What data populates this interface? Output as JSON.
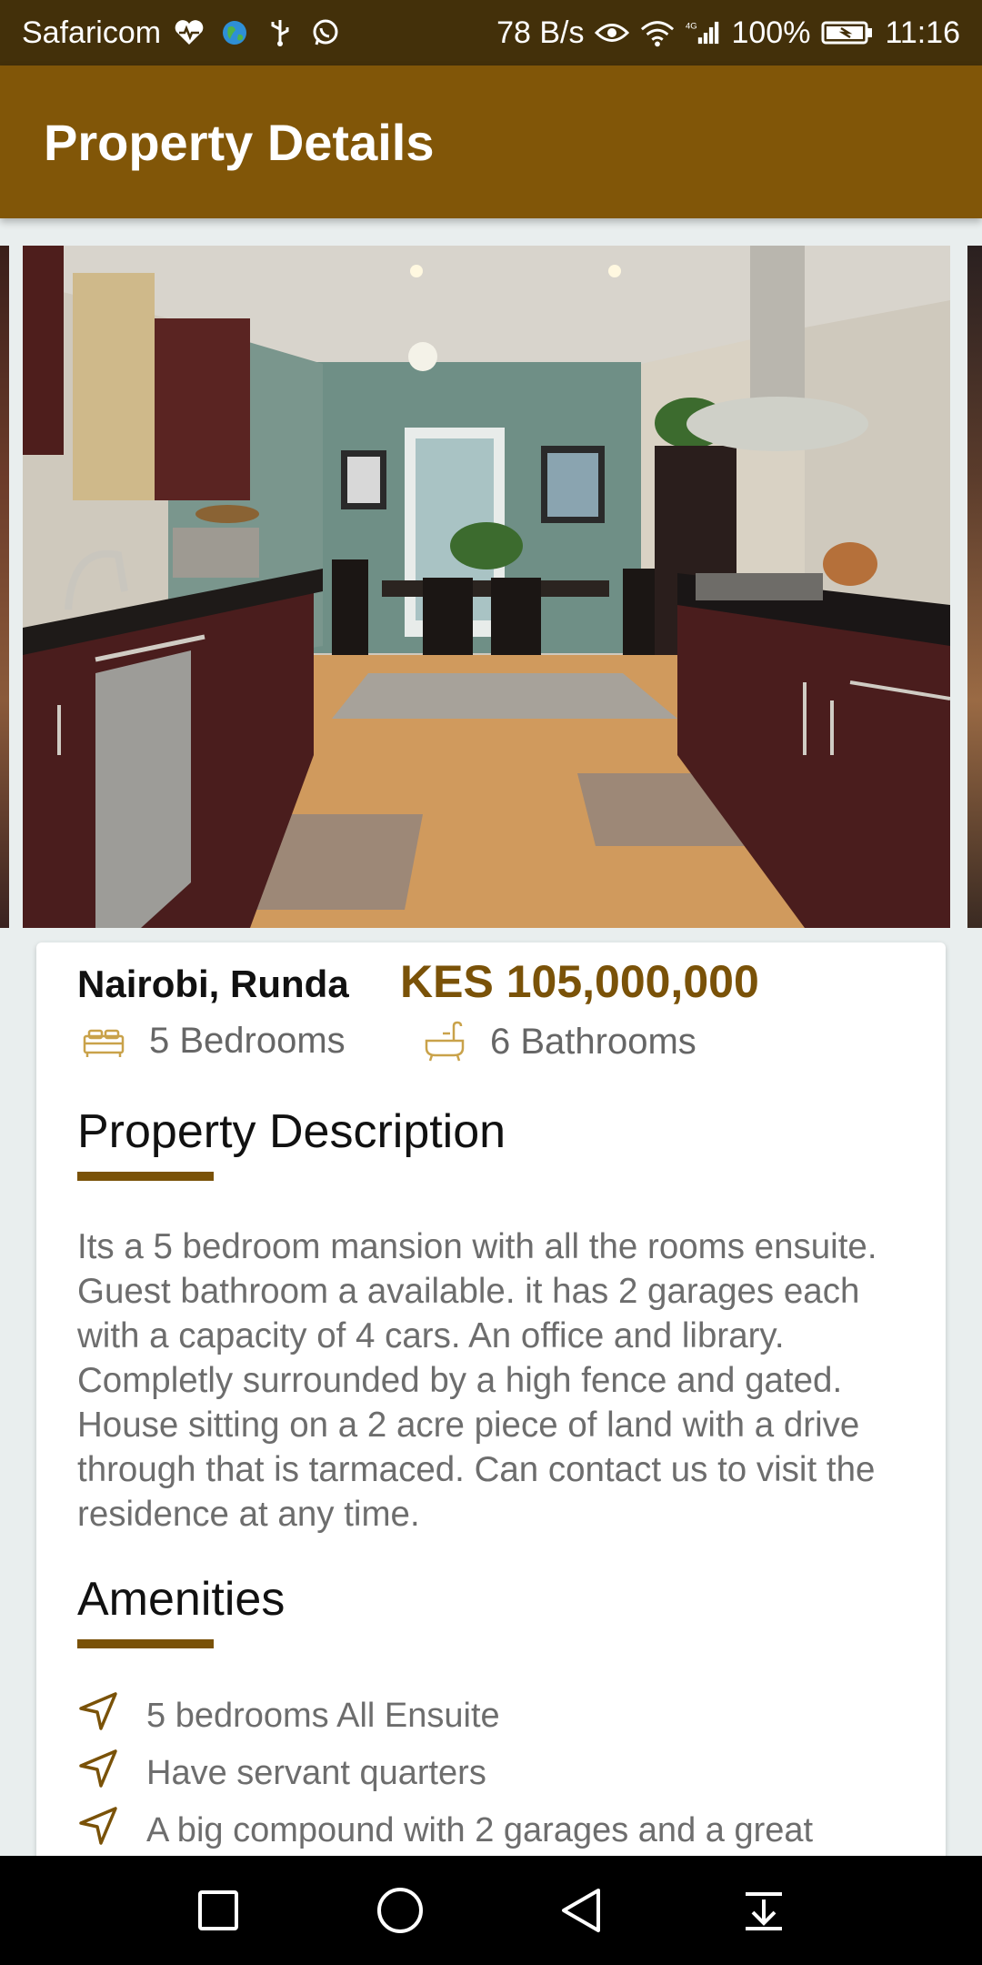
{
  "status_bar": {
    "carrier": "Safaricom",
    "left_icons": [
      "heart-rate-icon",
      "globe-icon",
      "usb-icon",
      "whatsapp-icon"
    ],
    "speed": "78 B/s",
    "right_icons": [
      "eye-icon",
      "wifi-icon",
      "4g-signal-icon"
    ],
    "battery": "100%",
    "time": "11:16"
  },
  "app_bar": {
    "title": "Property Details",
    "background": "#815608"
  },
  "gallery": {
    "image_description_icon": "kitchen-photo"
  },
  "property": {
    "location": "Nairobi, Runda",
    "price": "KES 105,000,000",
    "price_color": "#7a5208",
    "bedrooms": "5 Bedrooms",
    "bathrooms": "6 Bathrooms"
  },
  "description": {
    "title": "Property Description",
    "text": "Its a 5 bedroom mansion with all the rooms ensuite. Guest bathroom a available. it has 2 garages each with a capacity of 4 cars. An office and library. Completly surrounded by a high fence and gated. House sitting on a 2 acre piece of land with a drive through that is tarmaced. Can contact us to visit the residence at any time."
  },
  "amenities": {
    "title": "Amenities",
    "items": [
      "5 bedrooms All Ensuite",
      "Have servant quarters",
      "A big compound with 2 garages and a great"
    ]
  },
  "nav_bar": {
    "buttons": [
      "recent-apps-icon",
      "home-icon",
      "back-icon",
      "notification-pull-icon"
    ]
  }
}
